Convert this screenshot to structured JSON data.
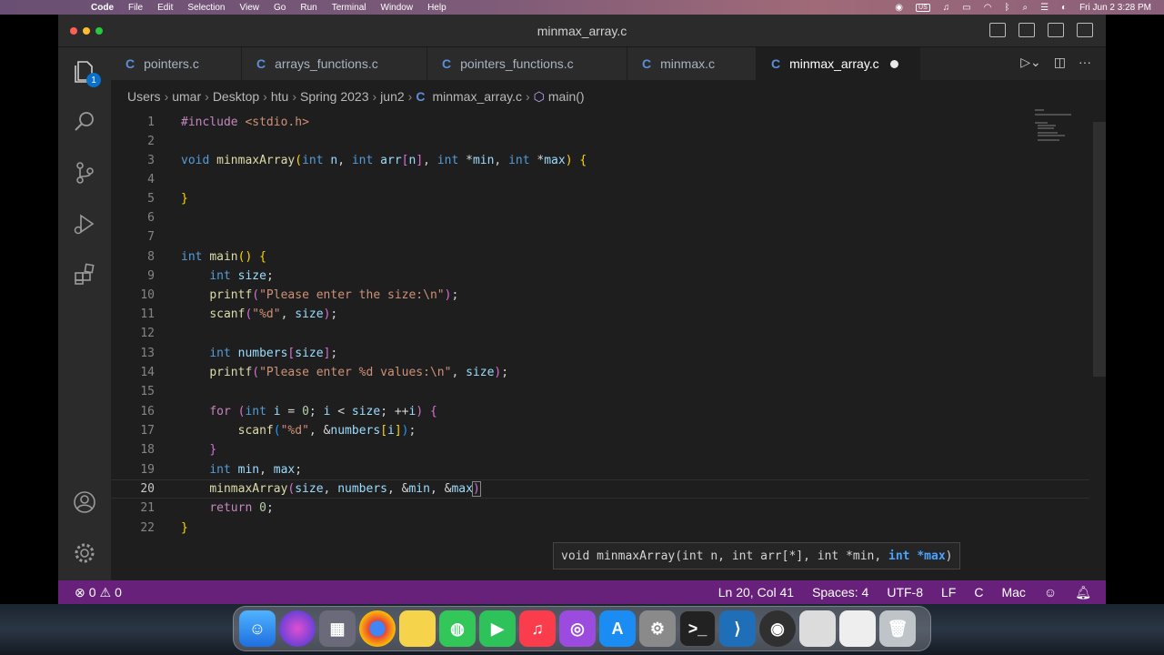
{
  "menubar": {
    "app": "Code",
    "items": [
      "File",
      "Edit",
      "Selection",
      "View",
      "Go",
      "Run",
      "Terminal",
      "Window",
      "Help"
    ],
    "input_source": "US",
    "datetime": "Fri Jun 2  3:28 PM"
  },
  "window": {
    "title": "minmax_array.c"
  },
  "activity": {
    "explorer_badge": "1"
  },
  "tabs": [
    {
      "label": "pointers.c"
    },
    {
      "label": "arrays_functions.c"
    },
    {
      "label": "pointers_functions.c"
    },
    {
      "label": "minmax.c"
    },
    {
      "label": "minmax_array.c"
    }
  ],
  "breadcrumb": {
    "parts": [
      "Users",
      "umar",
      "Desktop",
      "htu",
      "Spring 2023",
      "jun2"
    ],
    "file": "minmax_array.c",
    "symbol": "main()"
  },
  "editor": {
    "line_numbers": [
      "1",
      "2",
      "3",
      "4",
      "5",
      "6",
      "7",
      "8",
      "9",
      "10",
      "11",
      "12",
      "13",
      "14",
      "15",
      "16",
      "17",
      "18",
      "19",
      "20",
      "21",
      "22"
    ],
    "current_line": "20"
  },
  "tooltip": {
    "prefix": "void minmaxArray(int n, int arr[*], int *min, ",
    "active_param": "int *max",
    "suffix": ")"
  },
  "status": {
    "errors": "0",
    "warnings": "0",
    "position": "Ln 20, Col 41",
    "spaces": "Spaces: 4",
    "encoding": "UTF-8",
    "eol": "LF",
    "language": "C",
    "platform": "Mac"
  },
  "colors": {
    "statusbar": "#68217a",
    "keyword": "#569cd6",
    "function": "#dcdcaa",
    "string": "#ce9178"
  }
}
